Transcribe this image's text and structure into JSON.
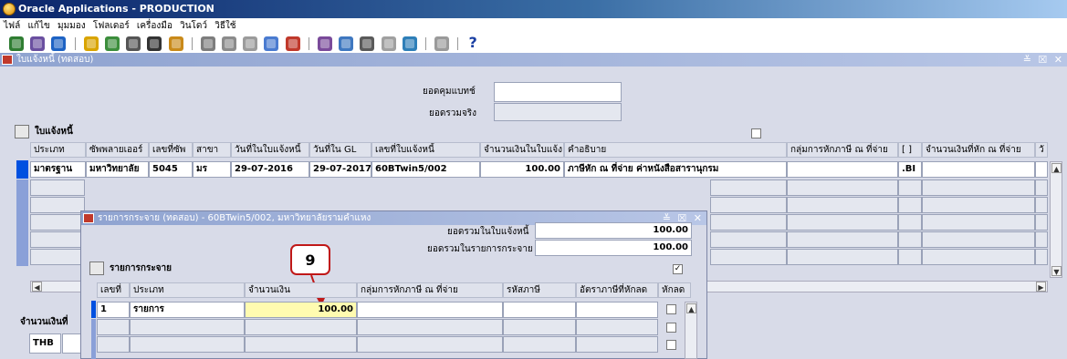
{
  "app_title": "Oracle Applications - PRODUCTION",
  "menu": [
    "ไฟล์",
    "แก้ไข",
    "มุมมอง",
    "โฟลเดอร์",
    "เครื่องมือ",
    "วินโดว์",
    "วิธีใช้"
  ],
  "toolbar": {
    "help_label": "?"
  },
  "invoice_window": {
    "title": "ใบแจ้งหนี้ (ทดสอบ)",
    "controls": "≚ ☒ ✕",
    "control_total_label": "ยอดคุมแบทช์",
    "actual_total_label": "ยอดรวมจริง",
    "section_label": "ใบแจ้งหนี้",
    "headers": [
      "ประเภท",
      "ซัพพลายเออร์",
      "เลขที่ซัพ",
      "สาขา",
      "วันที่ในใบแจ้งหนี้",
      "วันที่ใน GL",
      "เลขที่ใบแจ้งหนี้",
      "จำนวนเงินในใบแจ้ง",
      "คำอธิบาย",
      "กลุ่มการหักภาษี ณ ที่จ่าย",
      "[ ]",
      "จำนวนเงินที่หัก ณ ที่จ่าย",
      "วั"
    ],
    "row1": [
      "มาตรฐาน",
      "มหาวิทยาลัย",
      "5045",
      "มร",
      "29-07-2016",
      "29-07-2017",
      "60BTwin5/002",
      "100.00",
      "ภาษีหัก ณ ที่จ่าย ค่าหนังสือสารานุกรม",
      "",
      ".BI",
      "",
      ""
    ],
    "amount_section_label": "จำนวนเงินที่",
    "currency": "THB"
  },
  "dist_window": {
    "title": "รายการกระจาย (ทดสอบ) - 60BTwin5/002, มหาวิทยาลัยรามคำแหง",
    "controls": "≚ ☒ ✕",
    "invoice_total_label": "ยอดรวมในใบแจ้งหนี้",
    "invoice_total": "100.00",
    "dist_total_label": "ยอดรวมในรายการกระจาย",
    "dist_total": "100.00",
    "section_label": "รายการกระจาย",
    "headers": [
      "เลขที่",
      "ประเภท",
      "จำนวนเงิน",
      "กลุ่มการหักภาษี ณ ที่จ่าย",
      "รหัสภาษี",
      "อัตราภาษีที่หักลด",
      "หักลด"
    ],
    "row1": [
      "1",
      "รายการ",
      "100.00",
      "",
      "",
      ""
    ]
  },
  "callout": "9",
  "colors": {
    "selected_row_marker": "#0050e0",
    "highlight_field": "#fffbb0",
    "callout_border": "#c01818"
  }
}
